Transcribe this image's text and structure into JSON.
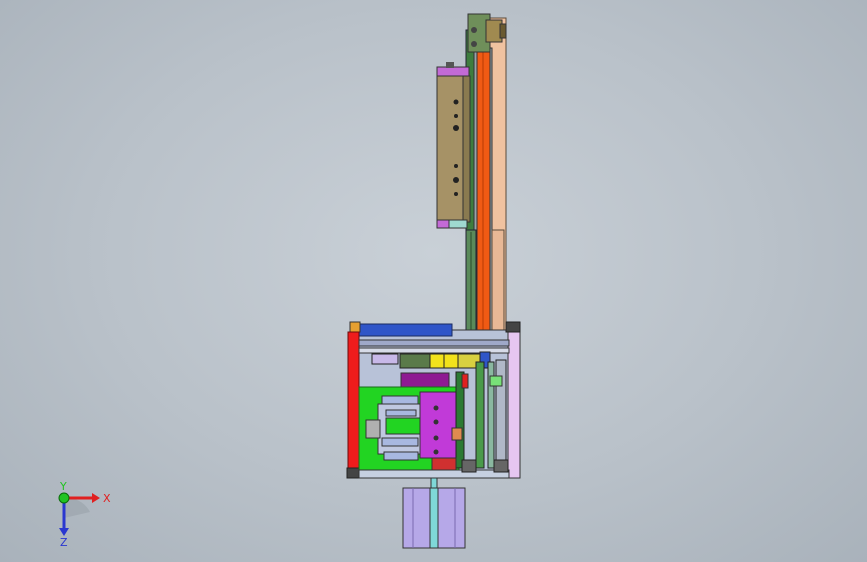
{
  "viewport": {
    "background_top": "#c9d0d7",
    "background_bottom": "#a9b2bb"
  },
  "triad": {
    "x_label": "X",
    "y_label": "Y",
    "z_label": "Z",
    "x_color": "#e02020",
    "y_color": "#22c322",
    "z_color": "#2a37d0"
  },
  "model": {
    "colors": {
      "frame_red": "#ee1c1c",
      "frame_blue": "#2f55c8",
      "lavender": "#b6a8e8",
      "green": "#22d422",
      "magenta": "#c13ad8",
      "purple": "#8e1a92",
      "orange": "#f05a14",
      "olive": "#a69266",
      "peach": "#f0c2a0",
      "yellow": "#f2e21c",
      "dark_green": "#2c7a34",
      "pink": "#ef9ad8"
    }
  }
}
